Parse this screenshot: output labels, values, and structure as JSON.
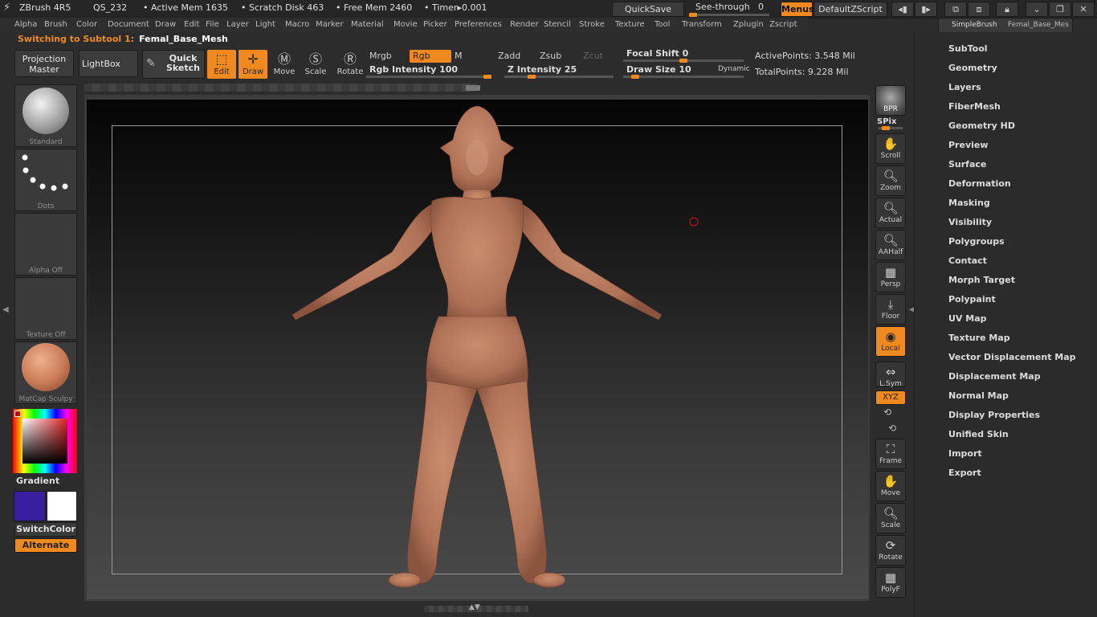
{
  "titlebar": {
    "app": "ZBrush 4R5",
    "doc": "QS_232",
    "active_mem": "• Active Mem 1635",
    "scratch": "• Scratch Disk 463",
    "free_mem": "• Free Mem 2460",
    "timer": "• Timer▸0.001",
    "quicksave": "QuickSave",
    "seethrough": "See-through",
    "seethrough_value": "0",
    "menus": "Menus",
    "default_zscript": "DefaultZScript"
  },
  "menus": [
    "Alpha",
    "Brush",
    "Color",
    "Document",
    "Draw",
    "Edit",
    "File",
    "Layer",
    "Light",
    "Macro",
    "Marker",
    "Material",
    "Movie",
    "Picker",
    "Preferences",
    "Render",
    "Stencil",
    "Stroke",
    "Texture",
    "Tool",
    "Transform",
    "Zplugin",
    "Zscript"
  ],
  "switching": {
    "label": "Switching to Subtool 1:",
    "value": "Femal_Base_Mesh"
  },
  "shelf": {
    "projection_master": "Projection Master",
    "lightbox": "LightBox",
    "quick_sketch": "Quick Sketch",
    "edit": "Edit",
    "draw": "Draw",
    "move": "Move",
    "scale": "Scale",
    "rotate": "Rotate",
    "mrgb": "Mrgb",
    "rgb": "Rgb",
    "m": "M",
    "zadd": "Zadd",
    "zsub": "Zsub",
    "zcut": "Zcut",
    "rgb_intensity": "Rgb Intensity 100",
    "z_intensity": "Z Intensity 25",
    "focal_shift": "Focal Shift 0",
    "draw_size": "Draw Size 10",
    "dynamic": "Dynamic",
    "active_points": "ActivePoints: 3.548 Mil",
    "total_points": "TotalPoints: 9.228 Mil"
  },
  "slider_levels": {
    "rgb_intensity": 1.0,
    "z_intensity": 0.25,
    "focal_shift": 0.5,
    "draw_size": 0.1,
    "seethrough": 0.0
  },
  "lefttray": {
    "brush": "Standard",
    "stroke": "Dots",
    "alpha": "Alpha Off",
    "texture": "Texture Off",
    "material": "MatCap Sculpy",
    "gradient": "Gradient",
    "switch_color": "SwitchColor",
    "alternate": "Alternate"
  },
  "colors": {
    "accent": "#f08a1e",
    "primary_swatch": "#3a1ea0",
    "secondary_swatch": "#ffffff",
    "skin": "#b87a5c"
  },
  "righttools": {
    "bpr": "BPR",
    "spix": "SPix",
    "scroll": "Scroll",
    "zoom": "Zoom",
    "actual": "Actual",
    "aahalf": "AAHalf",
    "persp": "Persp",
    "floor": "Floor",
    "local": "Local",
    "lsym": "L.Sym",
    "xyz": "XYZ",
    "frame": "Frame",
    "move": "Move",
    "scale": "Scale",
    "rotate": "Rotate",
    "polyf": "PolyF"
  },
  "subtool_strip": {
    "simplebrush": "SimpleBrush",
    "mesh": "Femal_Base_Mes"
  },
  "toolpanel": [
    "SubTool",
    "Geometry",
    "Layers",
    "FiberMesh",
    "Geometry HD",
    "Preview",
    "Surface",
    "Deformation",
    "Masking",
    "Visibility",
    "Polygroups",
    "Contact",
    "Morph Target",
    "Polypaint",
    "UV Map",
    "Texture Map",
    "Vector Displacement Map",
    "Displacement Map",
    "Normal Map",
    "Display Properties",
    "Unified Skin",
    "Import",
    "Export"
  ]
}
